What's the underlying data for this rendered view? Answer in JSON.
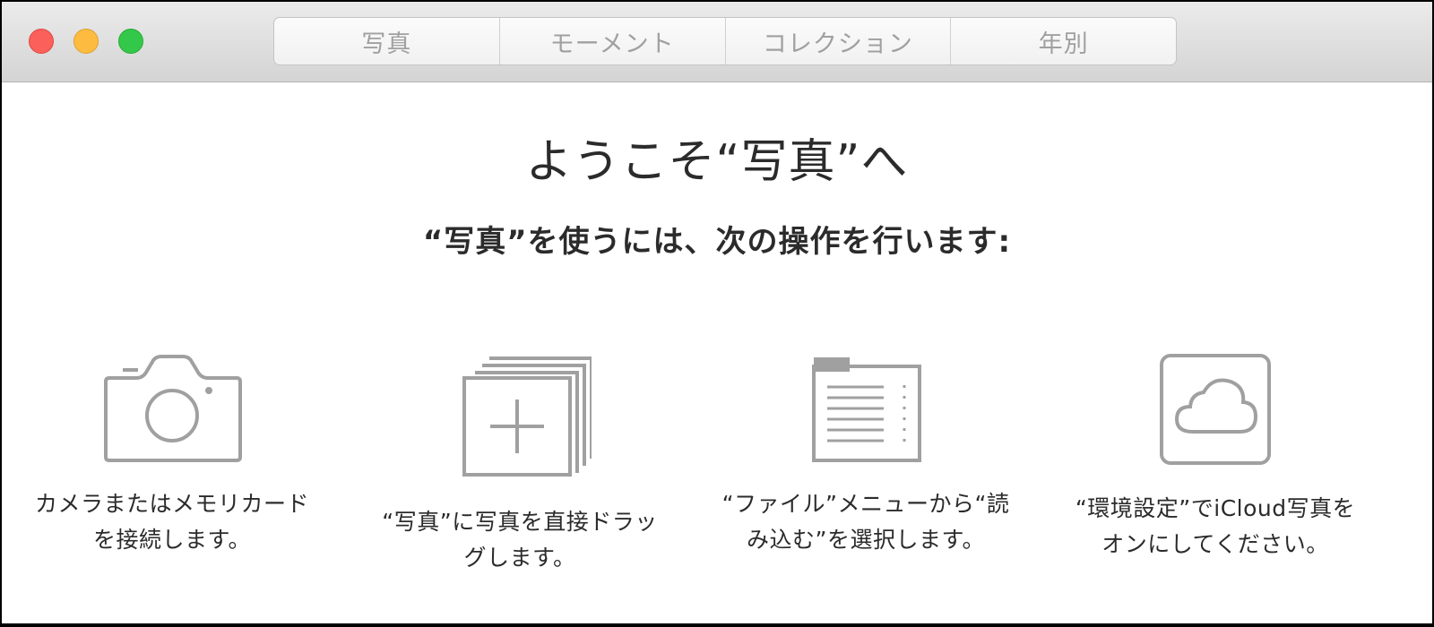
{
  "titlebar": {
    "tabs": [
      {
        "label": "写真"
      },
      {
        "label": "モーメント"
      },
      {
        "label": "コレクション"
      },
      {
        "label": "年別"
      }
    ]
  },
  "welcome": {
    "title": "ようこそ“写真”へ",
    "subtitle": "“写真”を使うには、次の操作を行います:"
  },
  "options": [
    {
      "icon": "camera-icon",
      "line1": "カメラまたはメモリカード",
      "line2": "を接続します。"
    },
    {
      "icon": "photo-stack-add-icon",
      "line1": "“写真”に写真を直接ドラッ",
      "line2": "グします。"
    },
    {
      "icon": "file-menu-icon",
      "line1": "“ファイル”メニューから“読",
      "line2": "み込む”を選択します。"
    },
    {
      "icon": "icloud-icon",
      "line1": "“環境設定”でiCloud写真を",
      "line2": "オンにしてください。"
    }
  ],
  "colors": {
    "icon_stroke": "#a0a0a0",
    "text": "#2b2b2b",
    "tab_text": "#a0a0a0"
  }
}
